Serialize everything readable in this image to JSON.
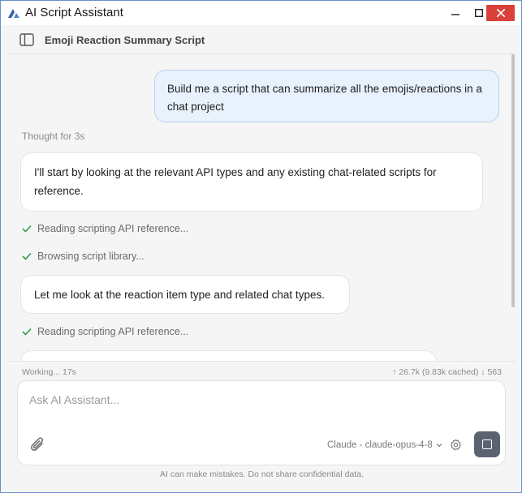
{
  "window": {
    "title": "AI Script Assistant",
    "close_color": "#d9403a",
    "icons": [
      "app-logo-icon",
      "minimize-icon",
      "maximize-icon",
      "close-icon"
    ]
  },
  "header": {
    "title": "Emoji Reaction Summary Script",
    "sidebar_toggle_icon": "sidebar-icon"
  },
  "chat": {
    "user_message": "Build me a script that can summarize all the emojis/reactions in a chat project",
    "thought_label": "Thought for 3s",
    "assistant_messages": [
      "I'll start by looking at the relevant API types and any existing chat-related scripts for reference.",
      "Let me look at the reaction item type and related chat types.",
      ""
    ],
    "steps": [
      "Reading scripting API reference...",
      "Browsing script library...",
      "Reading scripting API reference..."
    ],
    "check_color": "#2e9d48"
  },
  "status": {
    "working": "Working... 17s",
    "tokens": "↑ 26.7k (9.83k cached)  ↓ 563"
  },
  "input": {
    "placeholder": "Ask AI Assistant...",
    "model": "Claude - claude-opus-4-8",
    "icons": [
      "paperclip-icon",
      "chevron-down-icon",
      "gear-icon",
      "stop-icon"
    ]
  },
  "footer": {
    "disclaimer": "AI can make mistakes. Do not share confidential data."
  }
}
